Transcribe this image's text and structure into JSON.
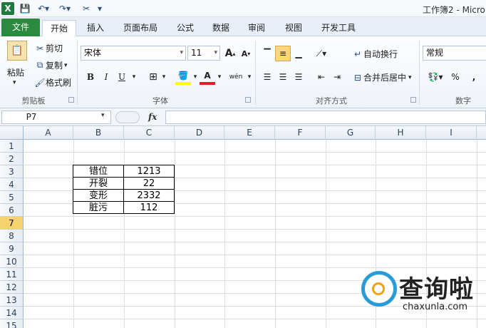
{
  "app": {
    "title": "工作簿2 - Micro",
    "logo": "X"
  },
  "tabs": [
    "文件",
    "开始",
    "插入",
    "页面布局",
    "公式",
    "数据",
    "审阅",
    "视图",
    "开发工具"
  ],
  "ribbon": {
    "clipboard": {
      "paste": "粘贴",
      "cut": "剪切",
      "copy": "复制",
      "format_painter": "格式刷",
      "label": "剪贴板"
    },
    "font": {
      "name": "宋体",
      "size": "11",
      "bold": "B",
      "italic": "I",
      "underline": "U",
      "label": "字体",
      "grow": "A",
      "shrink": "A",
      "phonetic": "wén"
    },
    "alignment": {
      "wrap": "自动换行",
      "merge": "合并后居中",
      "label": "对齐方式"
    },
    "number": {
      "format": "常规",
      "percent": "%",
      "comma": ",",
      "label": "数字"
    }
  },
  "formula_bar": {
    "name_box": "P7",
    "fx": "fx",
    "value": ""
  },
  "columns": [
    "A",
    "B",
    "C",
    "D",
    "E",
    "F",
    "G",
    "H",
    "I"
  ],
  "rows": [
    "1",
    "2",
    "3",
    "4",
    "5",
    "6",
    "7",
    "8",
    "9",
    "10",
    "11",
    "12",
    "13",
    "14",
    "15"
  ],
  "selected_row": "7",
  "table": [
    {
      "label": "错位",
      "value": "1213"
    },
    {
      "label": "开裂",
      "value": "22"
    },
    {
      "label": "变形",
      "value": "2332"
    },
    {
      "label": "脏污",
      "value": "112"
    }
  ],
  "watermark": {
    "text": "查询啦",
    "url": "chaxunla.com"
  },
  "colors": {
    "file_tab": "#2a8a3e",
    "selected_row": "#f8d26e",
    "watermark_blue": "#2a9bd6",
    "watermark_orange": "#f1a20e"
  }
}
